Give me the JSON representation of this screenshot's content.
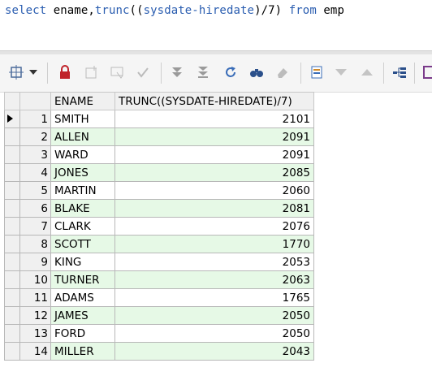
{
  "editor": {
    "sql_tokens": [
      {
        "text": "select",
        "cls": "kw"
      },
      {
        "text": " ename,",
        "cls": "tx"
      },
      {
        "text": "trunc",
        "cls": "kw"
      },
      {
        "text": "((",
        "cls": "tx"
      },
      {
        "text": "sysdate-hiredate",
        "cls": "kw"
      },
      {
        "text": ")/7) ",
        "cls": "tx"
      },
      {
        "text": "from",
        "cls": "kw"
      },
      {
        "text": " emp",
        "cls": "tx"
      }
    ]
  },
  "toolbar": {
    "icons": [
      "grid-options-icon",
      "lock-icon",
      "insert-record-icon",
      "delete-record-icon",
      "post-edit-icon",
      "fetch-next-icon",
      "fetch-last-icon",
      "refresh-icon",
      "find-icon",
      "clear-icon",
      "query-by-example-icon",
      "filter-icon",
      "sort-icon",
      "explain-icon",
      "save-icon"
    ]
  },
  "grid": {
    "columns": [
      "ENAME",
      "TRUNC((SYSDATE-HIREDATE)/7)"
    ],
    "current_row": 1,
    "rows": [
      {
        "n": "1",
        "ename": "SMITH",
        "val": "2101"
      },
      {
        "n": "2",
        "ename": "ALLEN",
        "val": "2091"
      },
      {
        "n": "3",
        "ename": "WARD",
        "val": "2091"
      },
      {
        "n": "4",
        "ename": "JONES",
        "val": "2085"
      },
      {
        "n": "5",
        "ename": "MARTIN",
        "val": "2060"
      },
      {
        "n": "6",
        "ename": "BLAKE",
        "val": "2081"
      },
      {
        "n": "7",
        "ename": "CLARK",
        "val": "2076"
      },
      {
        "n": "8",
        "ename": "SCOTT",
        "val": "1770"
      },
      {
        "n": "9",
        "ename": "KING",
        "val": "2053"
      },
      {
        "n": "10",
        "ename": "TURNER",
        "val": "2063"
      },
      {
        "n": "11",
        "ename": "ADAMS",
        "val": "1765"
      },
      {
        "n": "12",
        "ename": "JAMES",
        "val": "2050"
      },
      {
        "n": "13",
        "ename": "FORD",
        "val": "2050"
      },
      {
        "n": "14",
        "ename": "MILLER",
        "val": "2043"
      }
    ]
  }
}
